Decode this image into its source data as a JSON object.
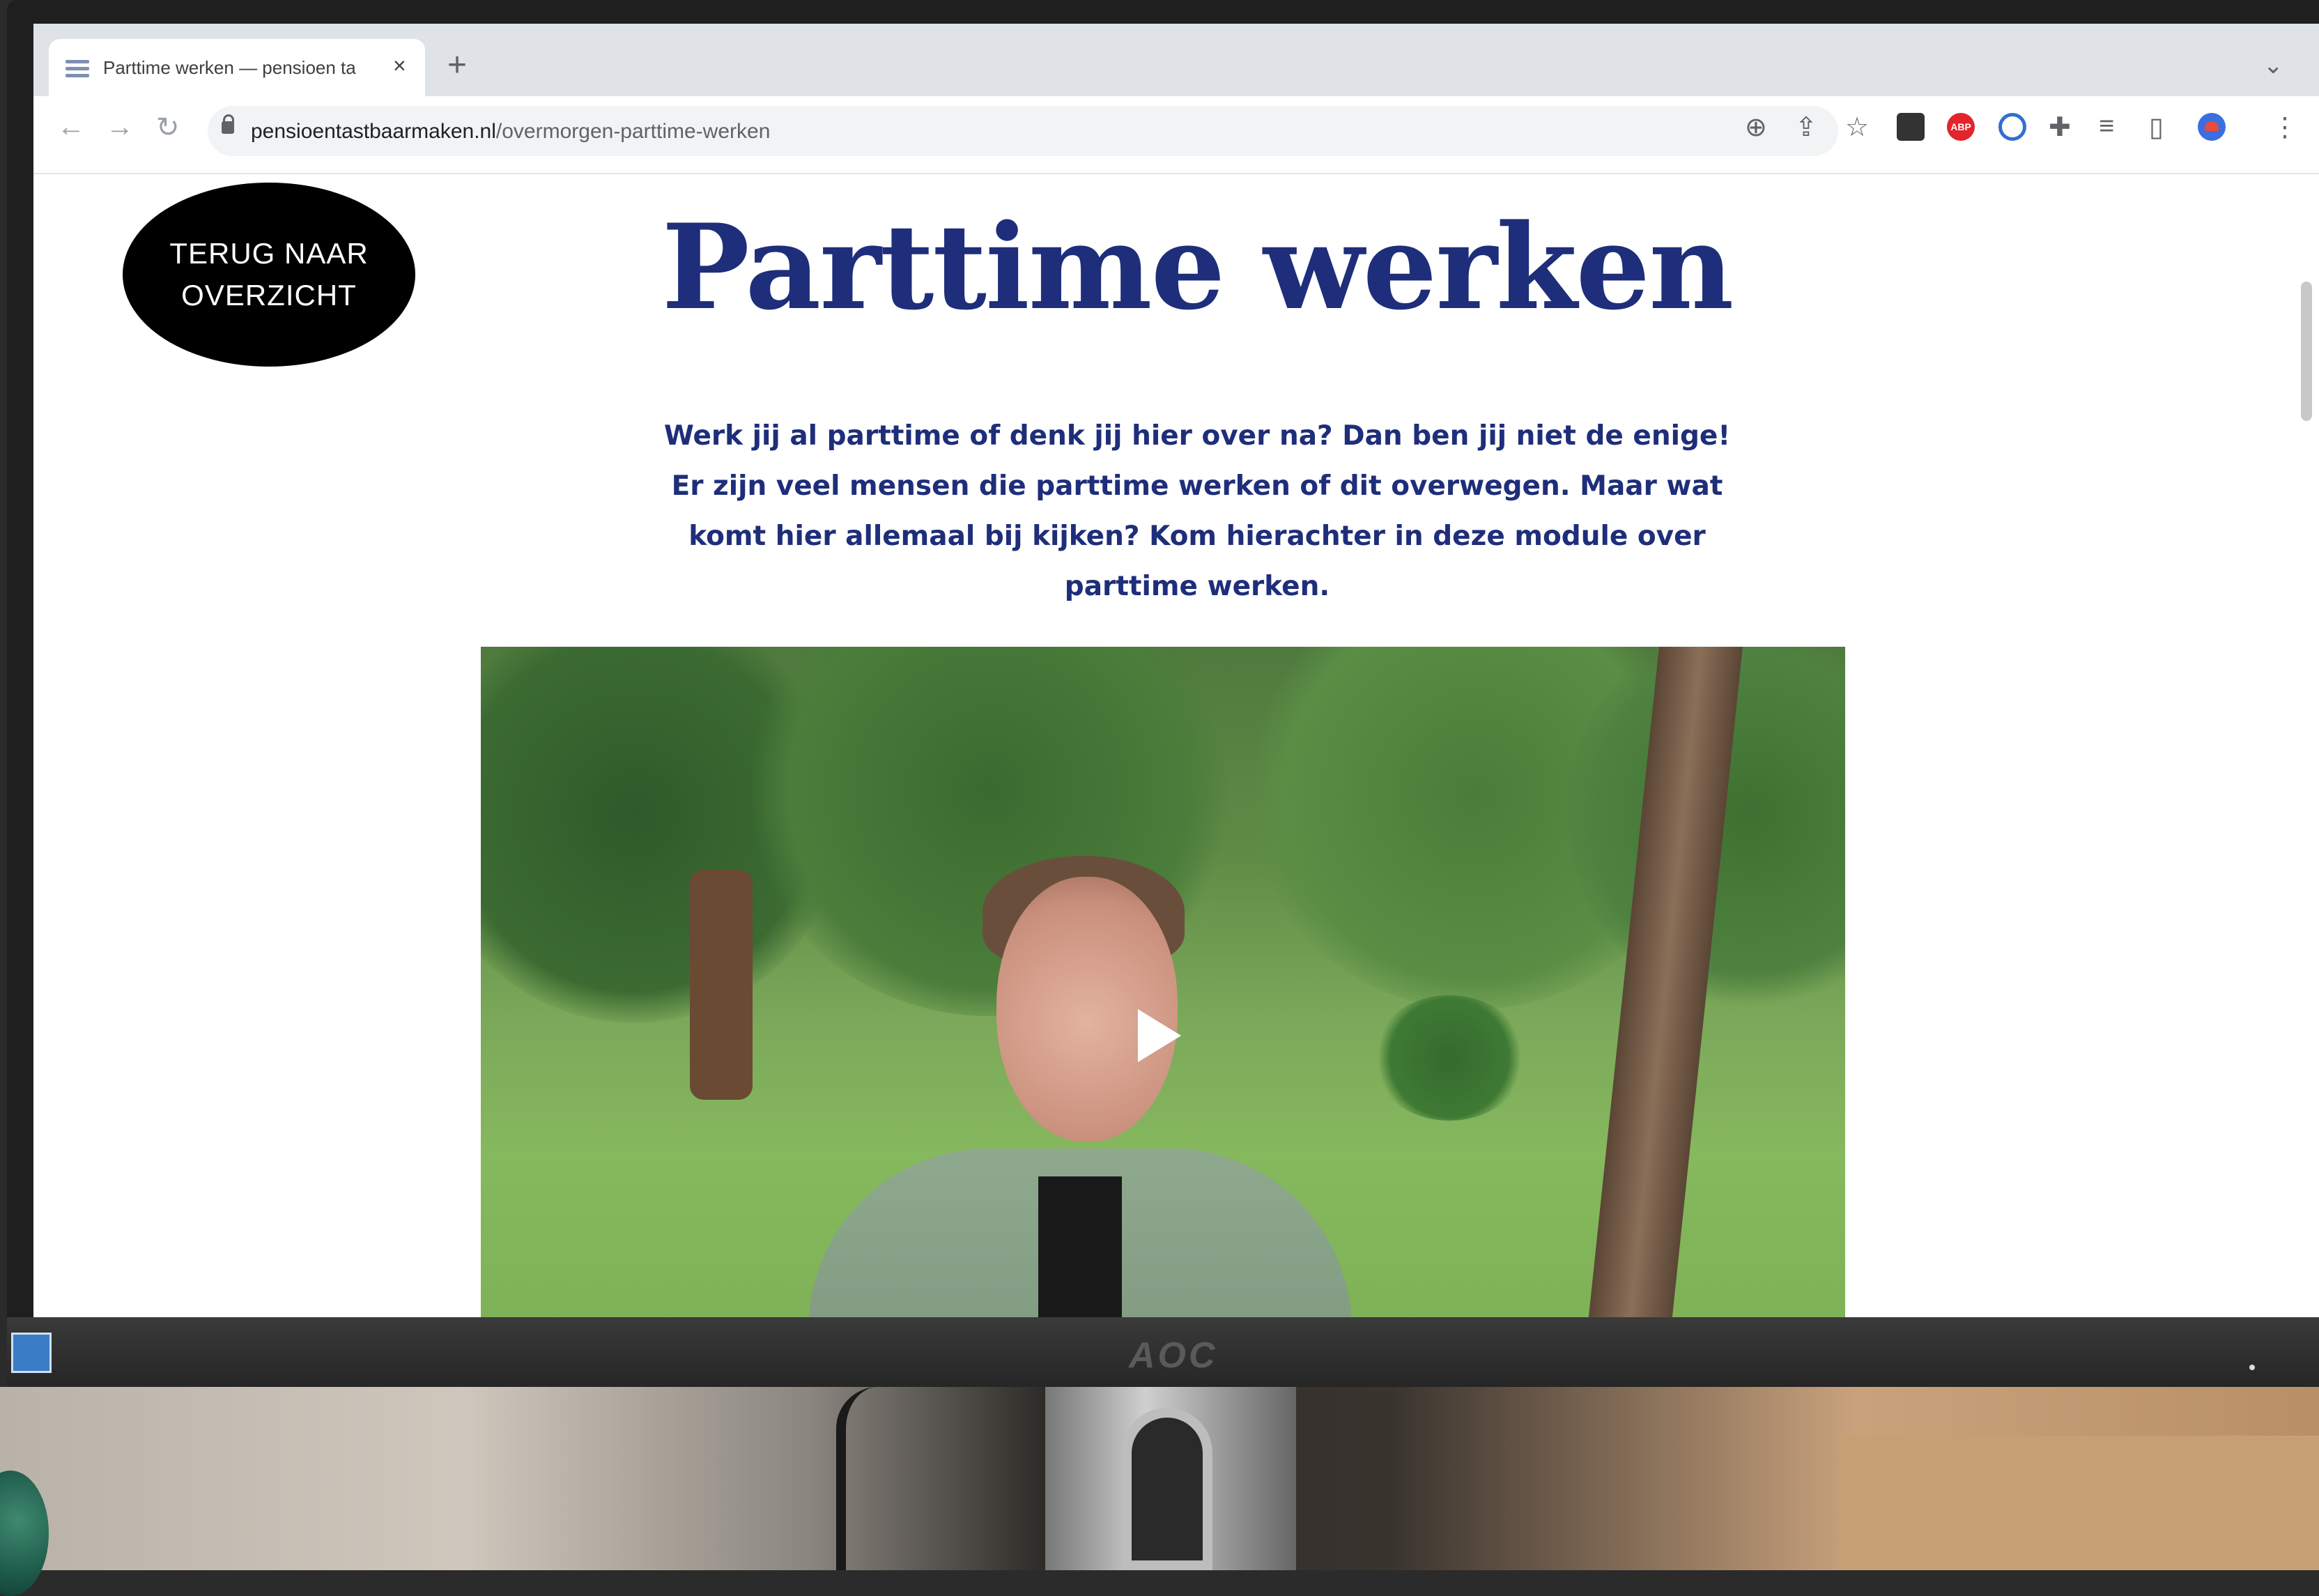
{
  "browser": {
    "tab_title": "Parttime werken — pensioen ta",
    "tab_close": "×",
    "new_tab": "+",
    "url_domain": "pensioentastbaarmaken.nl",
    "url_path": "/overmorgen-parttime-werken",
    "icons": [
      "back-icon",
      "forward-icon",
      "reload-icon",
      "lock-icon",
      "zoom-icon",
      "share-icon",
      "bookmark-star-icon",
      "extension-dark-icon",
      "adblock-icon",
      "extension-blue-icon",
      "puzzle-icon",
      "tab-search-icon",
      "side-panel-icon",
      "profile-avatar-icon",
      "more-menu-icon"
    ],
    "abp_label": "ABP"
  },
  "page": {
    "back_button": "TERUG NAAR OVERZICHT",
    "title": "Parttime werken",
    "intro": "Werk jij al parttime of denk jij hier over na? Dan ben jij niet de enige! Er zijn veel mensen die parttime werken of dit overwegen. Maar wat komt hier allemaal bij kijken? Kom hierachter in deze module over parttime werken."
  },
  "monitor": {
    "brand": "AOC"
  },
  "colors": {
    "title_blue": "#1e2e7a",
    "pill_black": "#000000"
  }
}
